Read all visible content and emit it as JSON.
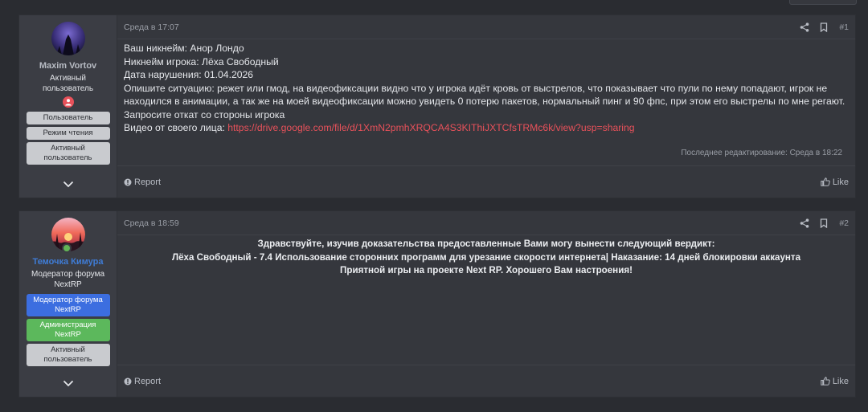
{
  "posts": [
    {
      "user": {
        "name": "Maxim Vortov",
        "title": "Активный пользователь",
        "banners": [
          "Пользователь",
          "Режим чтения",
          "Активный пользователь"
        ]
      },
      "date": "Среда в 17:07",
      "number": "#1",
      "lines": [
        "Ваш никнейм: Анор Лондо",
        "Никнейм игрока: Лёха Свободный",
        "Дата нарушения: 01.04.2026",
        "Опишите ситуацию: режет или гмод, на видеофиксации видно что у игрока идёт кровь от выстрелов, что показывает что пули по нему попадают, игрок не находился в анимации, а так же на моей видеофиксации можно увидеть 0 потерю пакетов, нормальный пинг и 90 фпс, при этом его выстрелы по мне регают. Запросите откат со стороны игрока"
      ],
      "video_label": "Видео от своего лица: ",
      "video_link": "https://drive.google.com/file/d/1XmN2pmhXRQCA4S3KIThiJXTCfsTRMc6k/view?usp=sharing",
      "edited": "Последнее редактирование: Среда в 18:22",
      "report_label": "Report",
      "like_label": "Like"
    },
    {
      "user": {
        "name": "Темочка Кимура",
        "title": "Модератор форума NextRP",
        "banners": [
          "Модератор форума NextRP",
          "Администрация NextRP",
          "Активный пользователь"
        ]
      },
      "date": "Среда в 18:59",
      "number": "#2",
      "lines": [
        "Здравствуйте, изучив доказательства предоставленные Вами могу вынести следующий вердикт:",
        "Лёха Свободный - 7.4 Использование сторонних программ для урезание скорости интернета| Наказание: 14 дней блокировки аккаунта",
        "Приятной игры на проекте Next RP. Хорошего Вам настроения!"
      ],
      "report_label": "Report",
      "like_label": "Like"
    }
  ],
  "colors": {
    "accent_red": "#e8515a",
    "moderator_blue": "#3c6ee0",
    "admin_green": "#5cb85c",
    "online_green": "#63b556"
  },
  "icons": [
    "share-icon",
    "bookmark-icon",
    "report-icon",
    "like-icon",
    "chevron-down-icon",
    "user-role-icon"
  ]
}
